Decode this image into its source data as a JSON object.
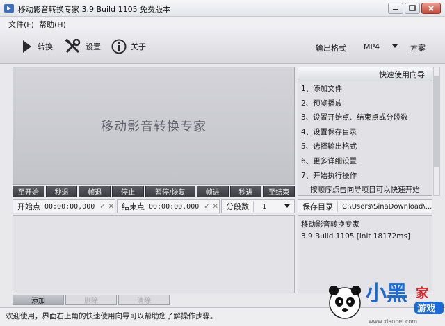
{
  "window": {
    "title": "移动影音转换专家 3.9 Build 1105 免费版本"
  },
  "menu": {
    "items": [
      "文件(F)",
      "帮助(H)"
    ]
  },
  "toolbar": {
    "convert_label": "转换",
    "settings_label": "设置",
    "about_label": "关于",
    "output_format_label": "输出格式",
    "output_format_value": "MP4",
    "scheme_label": "方案"
  },
  "preview": {
    "title": "移动影音转换专家"
  },
  "controls": [
    "至开始",
    "秒退",
    "帧退",
    "停止",
    "暂停/恢复",
    "帧进",
    "秒进",
    "至结束"
  ],
  "range": {
    "start_label": "开始点",
    "start_value": "00:00:00,000",
    "end_label": "结束点",
    "end_value": "00:00:00,000",
    "segments_label": "分段数",
    "segments_value": "1"
  },
  "wizard": {
    "header": "快速使用向导",
    "steps": [
      "1、添加文件",
      "2、预览播放",
      "3、设置开始点、结束点或分段数",
      "4、设置保存目录",
      "5、选择输出格式",
      "6、更多详细设置",
      "7、开始执行操作"
    ],
    "hint": "按顺序点击向导项目可以快速开始"
  },
  "output_dir": {
    "label": "保存目录",
    "value": "C:\\Users\\SinaDownload\\...\\"
  },
  "info": {
    "app_name": "移动影音转换专家",
    "build": "3.9 Build 1105 [init 18172ms]"
  },
  "tabs": {
    "add": "添加",
    "delete": "删除",
    "clear": "清除"
  },
  "status": {
    "text": "欢迎使用，界面右上角的快速使用向导可以帮助您了解操作步骤。"
  },
  "watermark": {
    "text": "小黑家游戏",
    "url": "www.xiaohei.com"
  },
  "colors": {
    "accent": "#3c3d43",
    "preview_bg": "#c8c9cf",
    "watermark_red": "#d8262b",
    "watermark_blue": "#1a6ad8"
  }
}
